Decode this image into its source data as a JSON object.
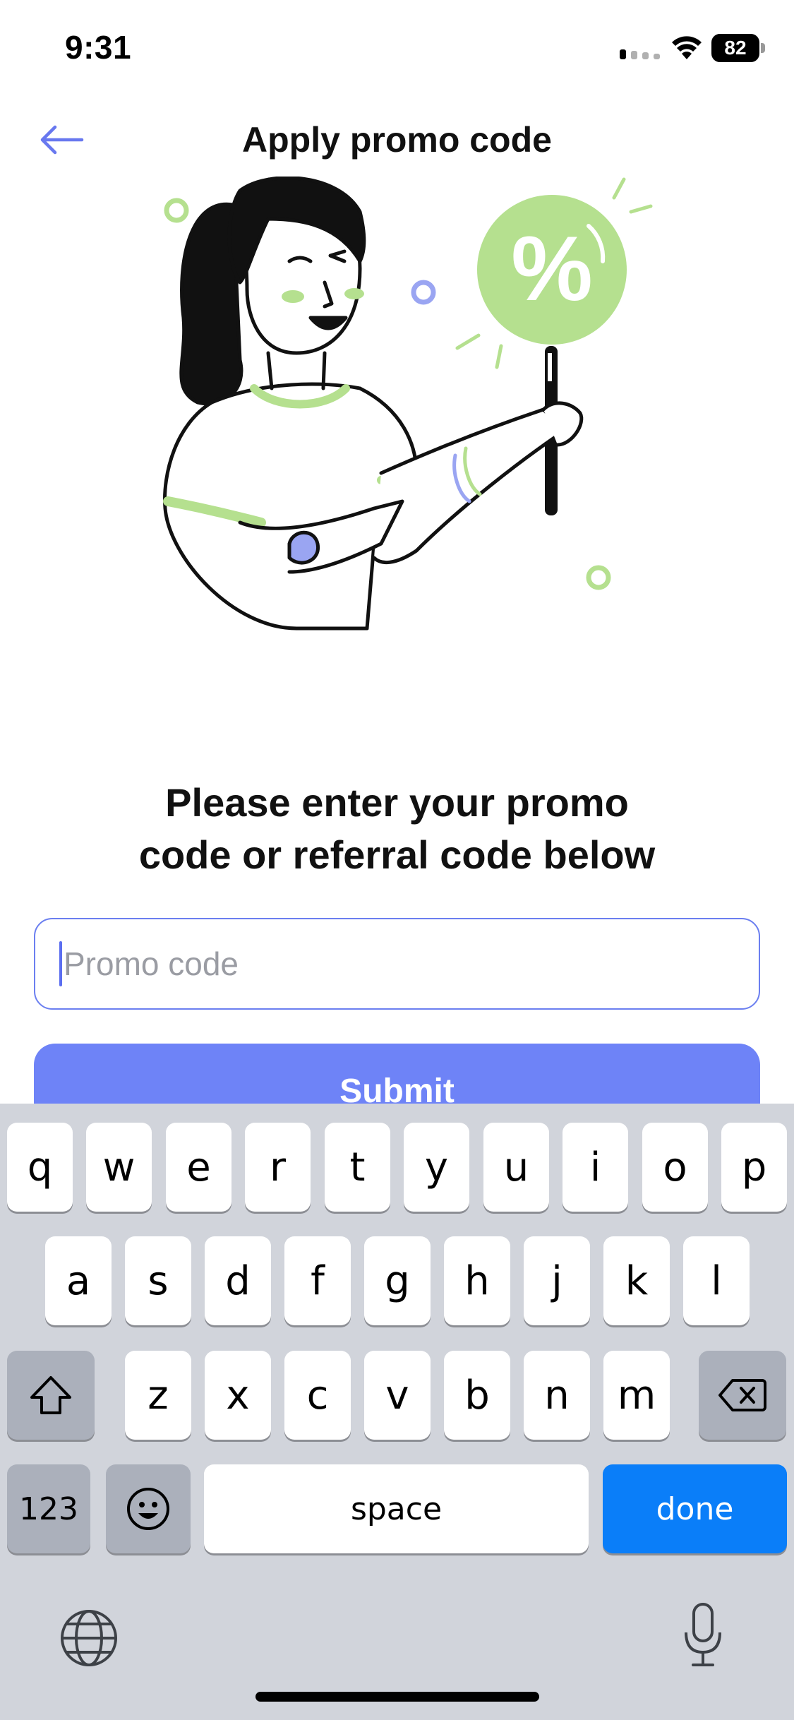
{
  "status_bar": {
    "time": "9:31",
    "battery": "82"
  },
  "header": {
    "title": "Apply promo code",
    "back_icon": "arrow-left-icon"
  },
  "main": {
    "heading_line1": "Please enter your promo",
    "heading_line2": "code or referral code below",
    "promo_input": {
      "placeholder": "Promo code",
      "value": ""
    },
    "submit_label": "Submit"
  },
  "keyboard": {
    "row1": [
      "q",
      "w",
      "e",
      "r",
      "t",
      "y",
      "u",
      "i",
      "o",
      "p"
    ],
    "row2": [
      "a",
      "s",
      "d",
      "f",
      "g",
      "h",
      "j",
      "k",
      "l"
    ],
    "row3": [
      "z",
      "x",
      "c",
      "v",
      "b",
      "n",
      "m"
    ],
    "numbers_label": "123",
    "space_label": "space",
    "done_label": "done"
  },
  "colors": {
    "accent": "#6e83f7",
    "illustration_green": "#b5e08f",
    "illustration_purple": "#9aa5f2",
    "keyboard_bg": "#d1d4db",
    "done_key": "#0a7ef9"
  }
}
